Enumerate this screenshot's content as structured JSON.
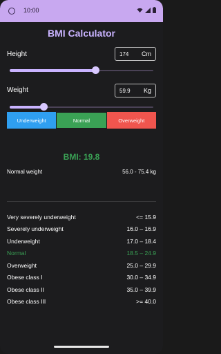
{
  "status": {
    "time": "10:00",
    "bg_color": "#c8a8f0"
  },
  "app": {
    "title": "BMI Calculator",
    "accent": "#c9b3ff"
  },
  "height": {
    "label": "Height",
    "value": "174",
    "unit": "Cm",
    "slider_fraction": 0.6
  },
  "weight": {
    "label": "Weight",
    "value": "59.9",
    "unit": "Kg",
    "slider_fraction": 0.24
  },
  "categories": [
    {
      "label": "Underweight",
      "color": "#2f9ff0"
    },
    {
      "label": "Normal",
      "color": "#3aa155"
    },
    {
      "label": "Overweight",
      "color": "#f0554e"
    }
  ],
  "result": {
    "bmi_text": "BMI: 19.8",
    "color": "#3aa155"
  },
  "normal_weight": {
    "label": "Normal weight",
    "range": "56.0 - 75.4 kg"
  },
  "classes": [
    {
      "name": "Very severely underweight",
      "range": "<= 15.9",
      "active": false
    },
    {
      "name": "Severely underweight",
      "range": "16.0 – 16.9",
      "active": false
    },
    {
      "name": "Underweight",
      "range": "17.0 – 18.4",
      "active": false
    },
    {
      "name": "Normal",
      "range": "18.5 – 24.9",
      "active": true
    },
    {
      "name": "Overweight",
      "range": "25.0 – 29.9",
      "active": false
    },
    {
      "name": "Obese class I",
      "range": "30.0 – 34.9",
      "active": false
    },
    {
      "name": "Obese class II",
      "range": "35.0 – 39.9",
      "active": false
    },
    {
      "name": "Obese class III",
      "range": ">= 40.0",
      "active": false
    }
  ]
}
